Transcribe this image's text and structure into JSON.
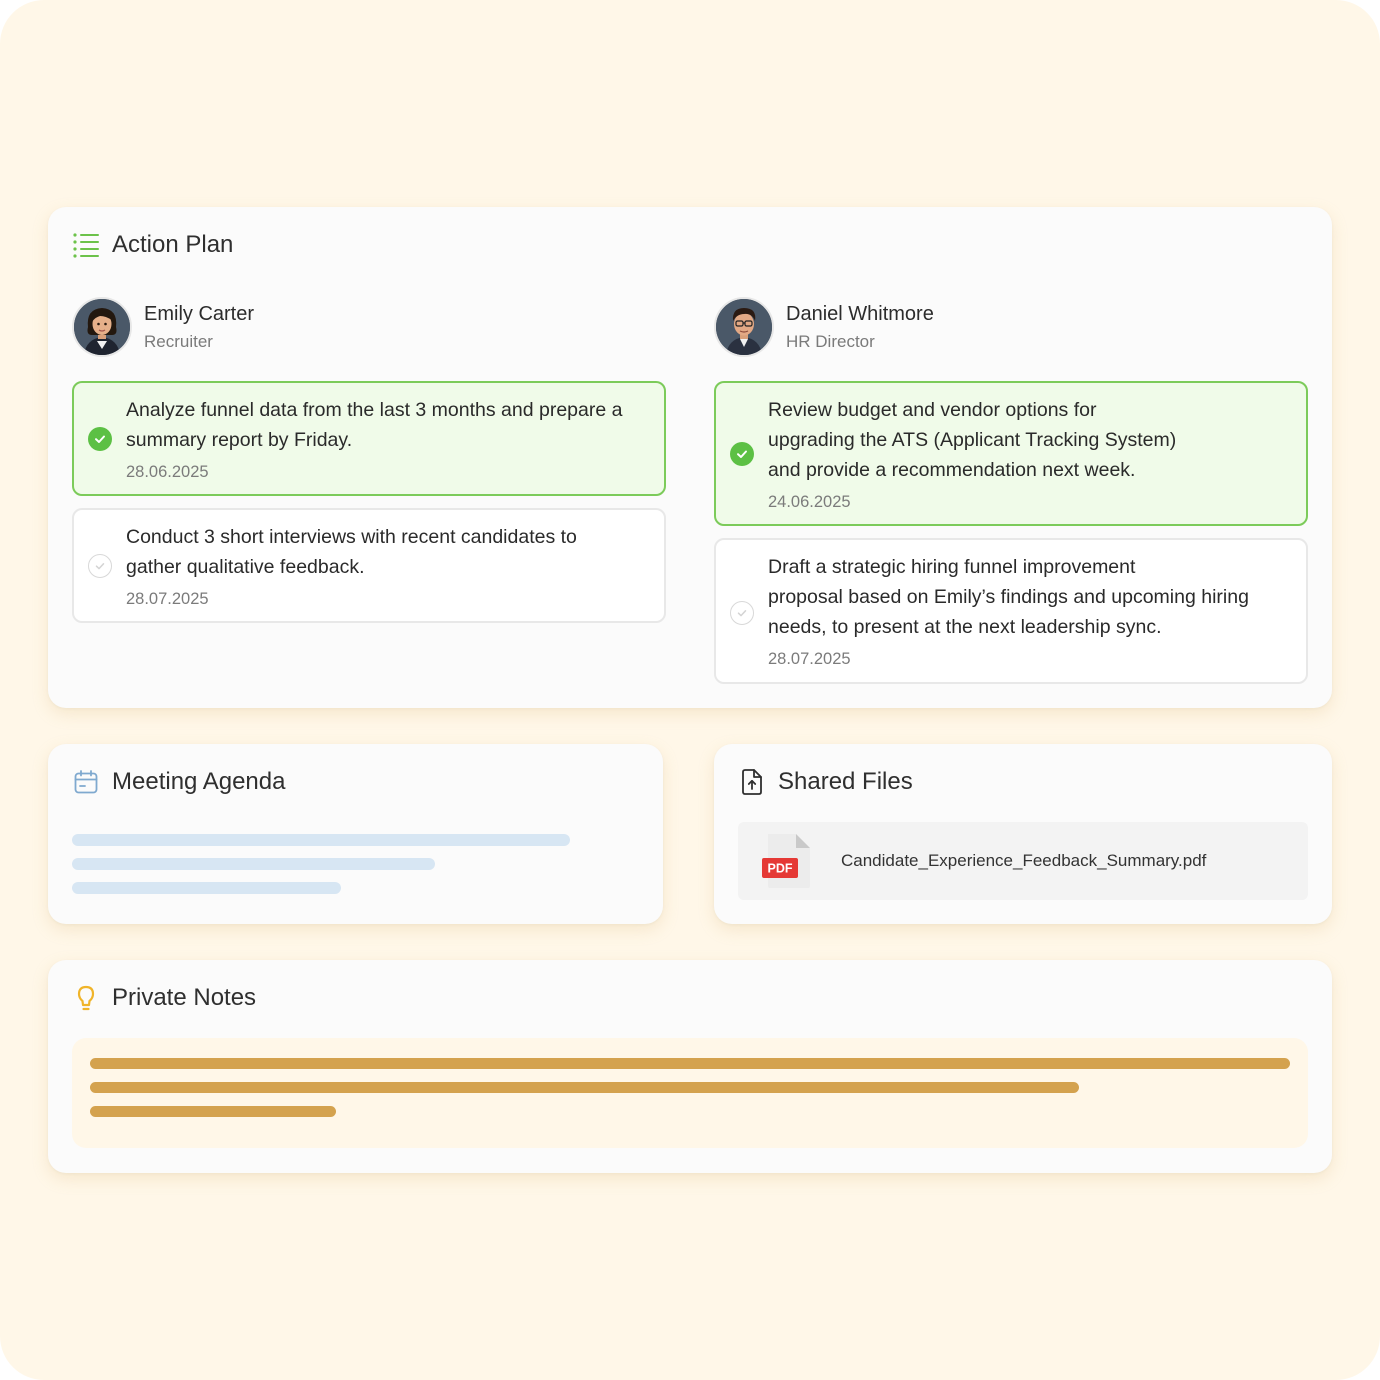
{
  "action_plan": {
    "title": "Action Plan",
    "accent": "#5cc044",
    "people": [
      {
        "name": "Emily Carter",
        "role": "Recruiter",
        "tasks": [
          {
            "status": "done",
            "lines": [
              "Analyze funnel data from the last 3 months and prepare a",
              "summary report by Friday."
            ],
            "date": "28.06.2025"
          },
          {
            "status": "todo",
            "lines": [
              "Conduct 3 short interviews with recent candidates to",
              "gather qualitative feedback."
            ],
            "date": "28.07.2025"
          }
        ]
      },
      {
        "name": "Daniel Whitmore",
        "role": "HR Director",
        "tasks": [
          {
            "status": "done",
            "lines": [
              "Review budget and vendor options for",
              "upgrading the ATS (Applicant Tracking System)",
              "and provide a recommendation next week."
            ],
            "date": "24.06.2025"
          },
          {
            "status": "todo",
            "lines": [
              "Draft a strategic hiring funnel improvement",
              "proposal based on Emily’s findings and upcoming hiring",
              "needs, to present at the next leadership sync."
            ],
            "date": "28.07.2025"
          }
        ]
      }
    ]
  },
  "meeting_agenda": {
    "title": "Meeting Agenda",
    "icon": "calendar-icon"
  },
  "shared_files": {
    "title": "Shared Files",
    "icon": "file-upload-icon",
    "files": [
      {
        "name": "Candidate_Experience_Feedback_Summary.pdf",
        "type_badge": "PDF"
      }
    ]
  },
  "private_notes": {
    "title": "Private Notes",
    "icon": "lightbulb-icon"
  }
}
